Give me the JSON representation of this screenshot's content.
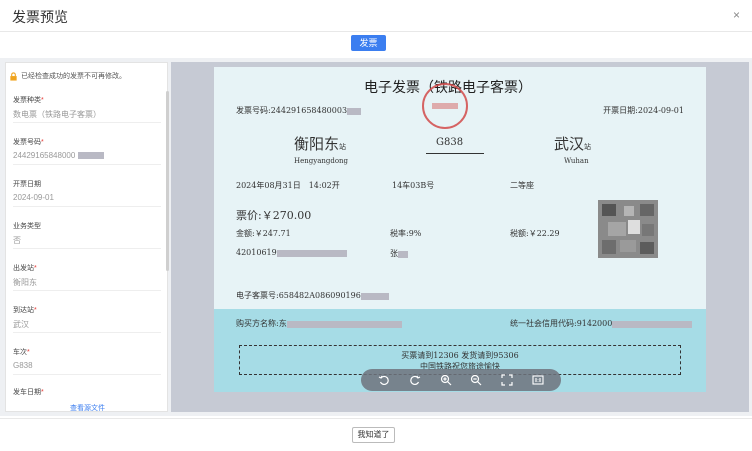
{
  "dialog": {
    "title": "发票预览",
    "close_glyph": "×"
  },
  "tabs": [
    {
      "label": "发票",
      "active": true
    }
  ],
  "sidebar": {
    "notice": "已经检查成功的发票不可再修改。",
    "fields": [
      {
        "label": "发票种类",
        "value": "数电票（铁路电子客票）"
      },
      {
        "label": "发票号码",
        "value": "24429165848000"
      },
      {
        "label": "开票日期",
        "value": "2024-09-01"
      },
      {
        "label": "业务类型",
        "value": "否"
      },
      {
        "label": "出发站",
        "value": "衡阳东"
      },
      {
        "label": "到达站",
        "value": "武汉"
      },
      {
        "label": "车次",
        "value": "G838"
      },
      {
        "label": "发车日期",
        "value": ""
      }
    ],
    "source_link": "查看源文件"
  },
  "invoice": {
    "title": "电子发票（铁路电子客票）",
    "invoice_no": "发票号码:244291658480003",
    "issue_date": "开票日期:2024-09-01",
    "from_station": "衡阳东",
    "from_pinyin": "Hengyangdong",
    "station_suffix": "站",
    "train_no": "G838",
    "to_station": "武汉",
    "to_pinyin": "Wuhan",
    "depart_time": "2024年08月31日　14:02开",
    "car_seat": "14车03B号",
    "seat_class": "二等座",
    "fare": "票价:￥270.00",
    "amount": "金额:￥247.71",
    "tax_rate": "税率:9%",
    "tax_amount": "税额:￥22.29",
    "id_no": "42010619",
    "passenger": "张",
    "eticket_no": "电子客票号:658482A086090196",
    "buyer_name": "购买方名称:东",
    "credit_code": "统一社会信用代码:9142000",
    "notice_line1": "买票请到12306 发货请到95306",
    "notice_line2": "中国铁路祝您旅途愉快"
  },
  "toolbar": {
    "icons": [
      "rotate-left-icon",
      "rotate-right-icon",
      "zoom-in-icon",
      "zoom-out-icon",
      "fit-screen-icon",
      "actual-size-icon"
    ]
  },
  "footer": {
    "ok_label": "我知道了"
  },
  "colors": {
    "accent": "#3b7ef0",
    "required": "#e53935",
    "invoice_bg": "#e7f3f6",
    "buyer_band": "#a6dce6",
    "seal": "#d24a4a"
  }
}
